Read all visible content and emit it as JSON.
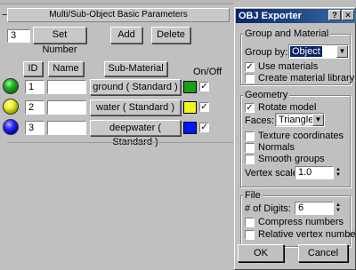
{
  "material_panel": {
    "rollout_title": "Multi/Sub-Object Basic Parameters",
    "collapse_glyph": "−",
    "count_value": "3",
    "set_number_label": "Set Number",
    "add_label": "Add",
    "delete_label": "Delete",
    "columns": {
      "id": "ID",
      "name": "Name",
      "sub_material": "Sub-Material",
      "on_off": "On/Off"
    },
    "rows": [
      {
        "id": "1",
        "name": "",
        "sub_material": "ground  ( Standard )",
        "swatch": "#19a019",
        "sphere": "green",
        "on": "✓"
      },
      {
        "id": "2",
        "name": "",
        "sub_material": "water  ( Standard )",
        "swatch": "#f5f51e",
        "sphere": "yellow",
        "on": "✓"
      },
      {
        "id": "3",
        "name": "",
        "sub_material": "deepwater  ( Standard )",
        "swatch": "#0014ff",
        "sphere": "blue",
        "on": "✓"
      }
    ]
  },
  "dialog": {
    "title": "OBJ Exporter",
    "help_glyph": "?",
    "close_glyph": "✕",
    "group_material": {
      "title": "Group and Material",
      "group_by_label": "Group by:",
      "group_by_value": "Object",
      "use_materials_label": "Use materials",
      "use_materials_checked": "✓",
      "create_library_label": "Create material library",
      "create_library_checked": ""
    },
    "geometry": {
      "title": "Geometry",
      "rotate_model_label": "Rotate model",
      "rotate_model_checked": "✓",
      "faces_label": "Faces:",
      "faces_value": "Triangles",
      "texture_coords_label": "Texture coordinates",
      "normals_label": "Normals",
      "smooth_groups_label": "Smooth groups",
      "vertex_scale_label": "Vertex scale:",
      "vertex_scale_value": "1.0"
    },
    "file": {
      "title": "File",
      "digits_label": "# of Digits:",
      "digits_value": "6",
      "compress_label": "Compress numbers",
      "relative_label": "Relative vertex numbers"
    },
    "ok_label": "OK",
    "cancel_label": "Cancel"
  },
  "colors": {
    "titlebar": "#0a246a",
    "panel": "#c0c0c0"
  }
}
